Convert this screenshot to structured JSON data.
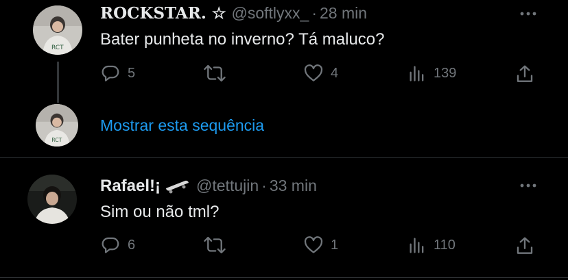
{
  "tweets": [
    {
      "name": "ROCKSTAR. ☆",
      "handle": "@softlyxx_",
      "separator": "·",
      "time": "28 min",
      "text": "Bater punheta no inverno? Tá maluco?",
      "replies": "5",
      "retweets": "",
      "likes": "4",
      "views": "139"
    },
    {
      "name": "Rafael!¡",
      "handle": "@tettujin",
      "separator": "·",
      "time": "33 min",
      "text": "Sim ou não tml?",
      "replies": "6",
      "retweets": "",
      "likes": "1",
      "views": "110"
    }
  ],
  "thread": {
    "show_label": "Mostrar esta sequência"
  },
  "icons": {
    "reply": "reply-icon",
    "retweet": "retweet-icon",
    "like": "heart-icon",
    "views": "views-icon",
    "share": "share-icon",
    "more": "more-icon",
    "skateboard": "skateboard-icon"
  },
  "colors": {
    "background": "#000000",
    "text": "#e7e9ea",
    "secondary": "#71767b",
    "link": "#1d9bf0",
    "divider": "#2f3336"
  }
}
